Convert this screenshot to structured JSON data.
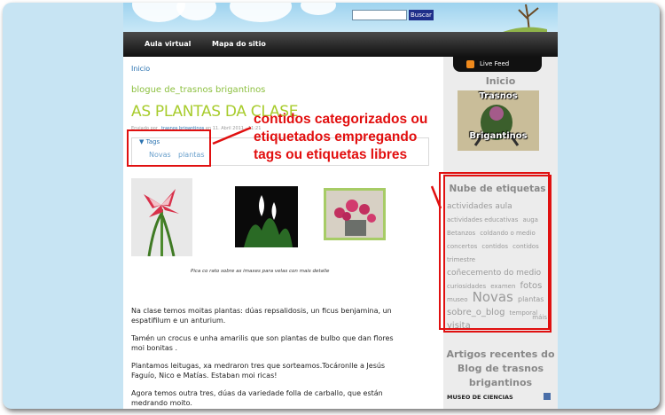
{
  "header": {
    "search_button": "Buscar"
  },
  "nav": {
    "items": [
      "Aula virtual",
      "Mapa do sitio"
    ]
  },
  "main": {
    "breadcrumb": "Inicio",
    "blog_title": "blogue de_trasnos brigantinos",
    "post_title": "AS PLANTAS DA CLASE",
    "meta_prefix": "Enviado por",
    "meta_author": "_trasnos brigantinos",
    "meta_date": "en 11. Abril 2011 - 11:21",
    "tags_label": "Tags",
    "tags": [
      "Novas",
      "plantas"
    ],
    "caption": "Pica co rato sobre as imaxes para velas con mais detalle",
    "paragraphs": [
      "Na clase temos moitas plantas: dúas repsalidosis, un ficus benjamina, un espatifilum e un anturium.",
      "Tamén un crocus e unha amarilis que son plantas de bulbo que dan flores moi bonitas .",
      "Plantamos leitugas, xa medraron tres que sorteamos.Tocáronlle a Jesús Faguío, Nico e Matías. Estaban moi ricas!",
      "Agora temos outra tres, dúas da variedade folla de carballo, que están medrando moito."
    ]
  },
  "annotation": "contidos categorizados ou etiquetados empregando tags ou etiquetas libres",
  "sidebar": {
    "live_feed": "Live Feed",
    "inicio": "Inicio",
    "logo_top": "Trasnos",
    "logo_bottom": "Brigantinos",
    "cloud_title": "Nube de etiquetas",
    "tags": [
      {
        "t": "actividades aula",
        "s": 9
      },
      {
        "t": "actividades educativas",
        "s": 7
      },
      {
        "t": "auga",
        "s": 7
      },
      {
        "t": "Betanzos",
        "s": 7
      },
      {
        "t": "coldando o medio",
        "s": 7
      },
      {
        "t": "concertos",
        "s": 7
      },
      {
        "t": "contidos",
        "s": 7
      },
      {
        "t": "contidos",
        "s": 7
      },
      {
        "t": "trimestre",
        "s": 7
      },
      {
        "t": "coñecemento do medio",
        "s": 9
      },
      {
        "t": "curiosidades",
        "s": 7
      },
      {
        "t": "examen",
        "s": 7
      },
      {
        "t": "fotos",
        "s": 10
      },
      {
        "t": "museo",
        "s": 7
      },
      {
        "t": "Novas",
        "s": 15
      },
      {
        "t": "plantas",
        "s": 8
      },
      {
        "t": "sobre_o_blog",
        "s": 10
      },
      {
        "t": "temporal",
        "s": 7
      },
      {
        "t": "visita",
        "s": 10
      }
    ],
    "mais": "máis",
    "recent_title": "Artigos recentes do Blog de trasnos brigantinos",
    "recent_item": "MUSEO DE CIENCIAS"
  }
}
